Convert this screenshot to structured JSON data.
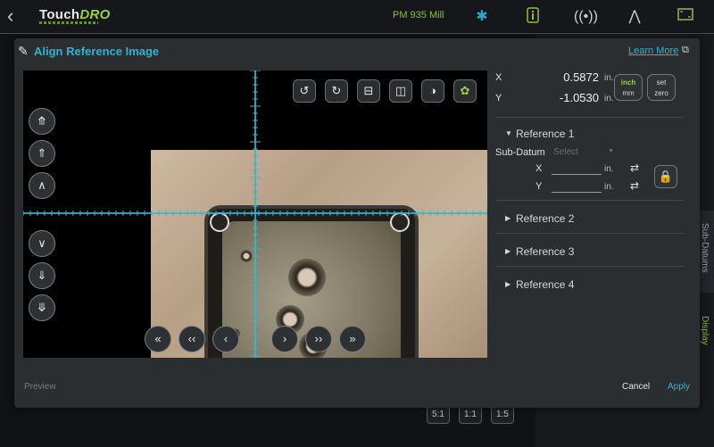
{
  "topbar": {
    "logo_main": "Touch",
    "logo_accent": "DRO",
    "machine": "PM 935 Mill",
    "icons": [
      "back-arrow-icon",
      "bluetooth-icon",
      "info-icon",
      "wireless-icon",
      "compass-icon",
      "fullscreen-icon"
    ]
  },
  "background": {
    "tabs": [
      "Sub-Datums",
      "Display"
    ],
    "ratios": [
      "5:1",
      "1:1",
      "1:5"
    ]
  },
  "modal": {
    "title": "Align Reference Image",
    "learn_more": "Learn More",
    "toolbar_icons": [
      "rotate-ccw-icon",
      "rotate-cw-icon",
      "flip-vertical-icon",
      "flip-horizontal-icon",
      "contrast-icon",
      "palette-icon"
    ],
    "coords": {
      "x_label": "X",
      "x_value": "0.5872",
      "y_label": "Y",
      "y_value": "-1.0530",
      "unit": "in.",
      "unit_active": "inch",
      "unit_inactive": "mm",
      "set_zero_line1": "set",
      "set_zero_line2": "zero"
    },
    "references": [
      {
        "label": "Reference 1",
        "expanded": true
      },
      {
        "label": "Reference 2",
        "expanded": false
      },
      {
        "label": "Reference 3",
        "expanded": false
      },
      {
        "label": "Reference 4",
        "expanded": false
      }
    ],
    "ref1": {
      "sub_datum_label": "Sub-Datum",
      "select_placeholder": "Select",
      "x_label": "X",
      "y_label": "Y",
      "unit": "in."
    },
    "footer": {
      "preview": "Preview",
      "cancel": "Cancel",
      "apply": "Apply"
    }
  },
  "colors": {
    "accent": "#2ab4d6",
    "green": "#8fbf3a",
    "crosshair": "#39b4cc",
    "lock": "#e2a528"
  }
}
